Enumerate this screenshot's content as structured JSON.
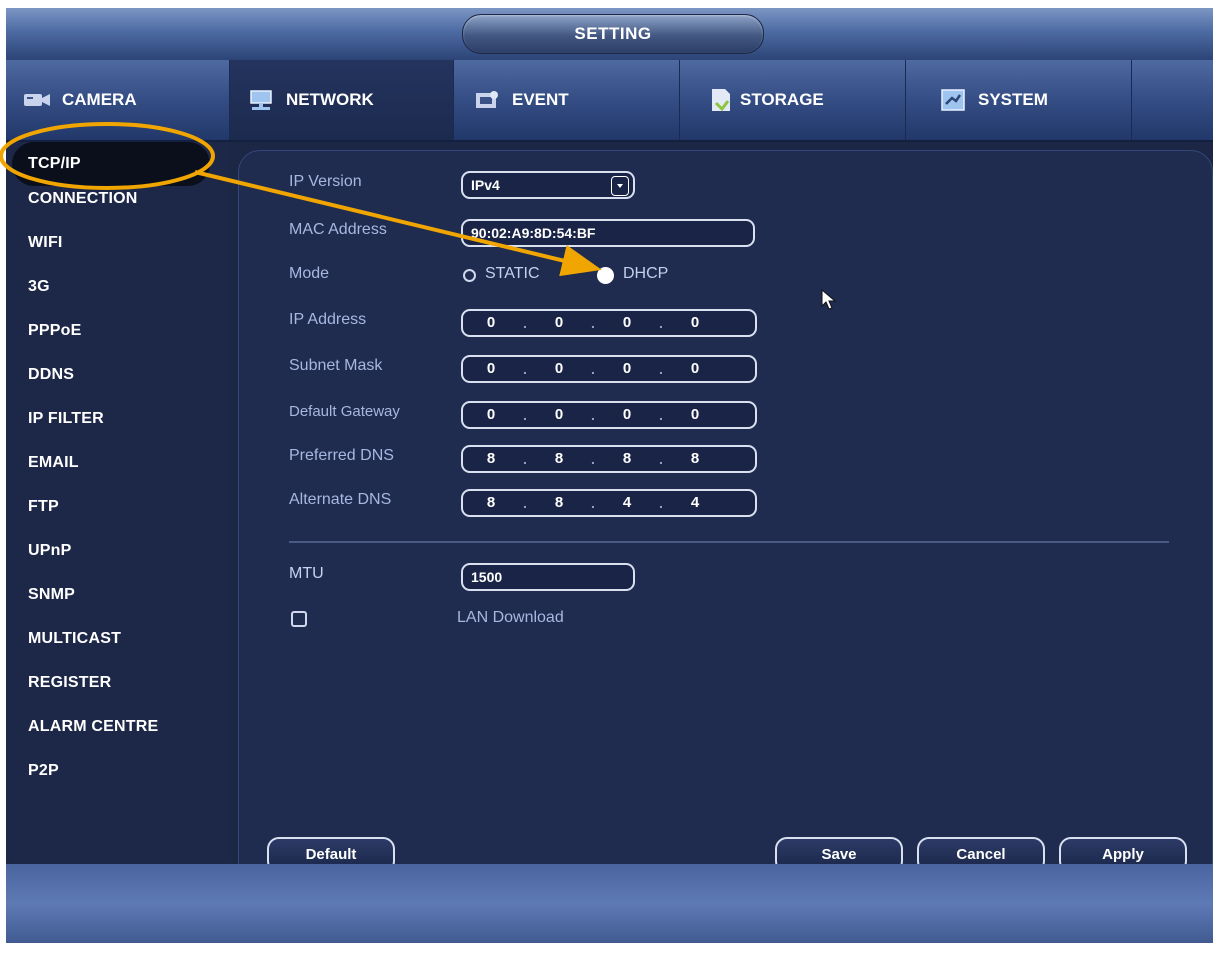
{
  "window": {
    "title": "SETTING"
  },
  "tabs": [
    {
      "label": "CAMERA",
      "icon": "camera-icon"
    },
    {
      "label": "NETWORK",
      "icon": "network-icon",
      "active": true
    },
    {
      "label": "EVENT",
      "icon": "event-icon"
    },
    {
      "label": "STORAGE",
      "icon": "storage-icon"
    },
    {
      "label": "SYSTEM",
      "icon": "system-icon"
    }
  ],
  "sidebar": {
    "items": [
      "TCP/IP",
      "CONNECTION",
      "WIFI",
      "3G",
      "PPPoE",
      "DDNS",
      "IP FILTER",
      "EMAIL",
      "FTP",
      "UPnP",
      "SNMP",
      "MULTICAST",
      "REGISTER",
      "ALARM CENTRE",
      "P2P"
    ],
    "active": "TCP/IP"
  },
  "form": {
    "ip_version": {
      "label": "IP Version",
      "value": "IPv4"
    },
    "mac": {
      "label": "MAC Address",
      "value": "90:02:A9:8D:54:BF"
    },
    "mode": {
      "label": "Mode",
      "options": [
        "STATIC",
        "DHCP"
      ],
      "selected": "DHCP"
    },
    "ip_address": {
      "label": "IP Address",
      "octets": [
        "0",
        "0",
        "0",
        "0"
      ]
    },
    "subnet": {
      "label": "Subnet Mask",
      "octets": [
        "0",
        "0",
        "0",
        "0"
      ]
    },
    "gateway": {
      "label": "Default Gateway",
      "octets": [
        "0",
        "0",
        "0",
        "0"
      ]
    },
    "dns1": {
      "label": "Preferred DNS",
      "octets": [
        "8",
        "8",
        "8",
        "8"
      ]
    },
    "dns2": {
      "label": "Alternate DNS",
      "octets": [
        "8",
        "8",
        "4",
        "4"
      ]
    },
    "mtu": {
      "label": "MTU",
      "value": "1500"
    },
    "lan_download": {
      "label": "LAN Download",
      "checked": false
    }
  },
  "buttons": {
    "default": "Default",
    "save": "Save",
    "cancel": "Cancel",
    "apply": "Apply"
  },
  "annotation": {
    "color": "#f0a500"
  },
  "colors": {
    "background": "#1c2746",
    "panel": "#1f2c50",
    "accent": "#4d6ba3"
  }
}
